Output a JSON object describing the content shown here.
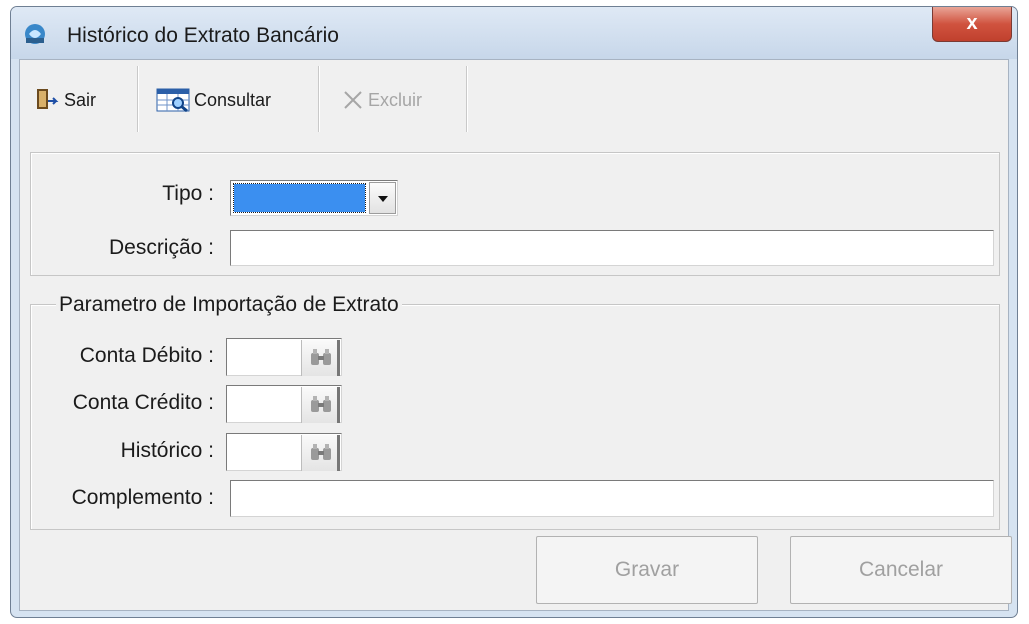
{
  "window": {
    "title": "Histórico do Extrato Bancário",
    "close_label": "x"
  },
  "toolbar": {
    "sair": "Sair",
    "consultar": "Consultar",
    "excluir": "Excluir"
  },
  "form": {
    "tipo_label": "Tipo :",
    "tipo_value": "",
    "descricao_label": "Descrição :",
    "descricao_value": ""
  },
  "import_params": {
    "legend": "Parametro de Importação de Extrato",
    "conta_debito_label": "Conta Débito :",
    "conta_credito_label": "Conta Crédito :",
    "historico_label": "Histórico :",
    "complemento_label": "Complemento :"
  },
  "actions": {
    "gravar": "Gravar",
    "cancelar": "Cancelar"
  },
  "colors": {
    "selection": "#3b8ff0",
    "close_button": "#c9483a"
  }
}
